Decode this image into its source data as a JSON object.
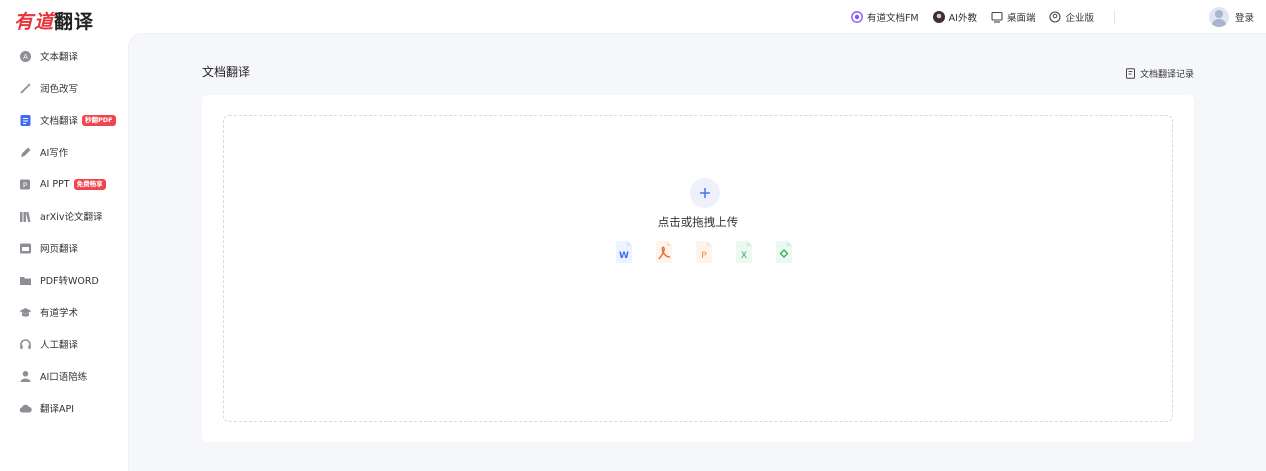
{
  "logo": {
    "brand": "有道",
    "product": "翻译"
  },
  "topnav": {
    "items": [
      {
        "label": "有道文档FM",
        "icon": "podcast-icon"
      },
      {
        "label": "AI外教",
        "icon": "tutor-avatar-icon"
      },
      {
        "label": "桌面端",
        "icon": "desktop-icon"
      },
      {
        "label": "企业版",
        "icon": "enterprise-icon"
      }
    ],
    "login": "登录"
  },
  "sidebar": {
    "items": [
      {
        "label": "文本翻译",
        "icon": "text-translate-icon"
      },
      {
        "label": "润色改写",
        "icon": "magic-wand-icon"
      },
      {
        "label": "文档翻译",
        "icon": "document-icon",
        "badge": "秒翻PDF"
      },
      {
        "label": "AI写作",
        "icon": "pen-icon"
      },
      {
        "label": "AI PPT",
        "icon": "ppt-icon",
        "badge": "免费畅享"
      },
      {
        "label": "arXiv论文翻译",
        "icon": "books-icon"
      },
      {
        "label": "网页翻译",
        "icon": "webpage-icon"
      },
      {
        "label": "PDF转WORD",
        "icon": "folder-icon"
      },
      {
        "label": "有道学术",
        "icon": "graduation-cap-icon"
      },
      {
        "label": "人工翻译",
        "icon": "headset-icon"
      },
      {
        "label": "AI口语陪练",
        "icon": "person-icon"
      },
      {
        "label": "翻译API",
        "icon": "cloud-icon"
      }
    ]
  },
  "main": {
    "title": "文档翻译",
    "history": "文档翻译记录",
    "upload_text": "点击或拖拽上传",
    "file_types": [
      "word-file-icon",
      "pdf-file-icon",
      "ppt-file-icon",
      "excel-file-icon",
      "image-file-icon"
    ]
  },
  "colors": {
    "brand_red": "#e8343b",
    "badge_red": "#f0454f",
    "accent_blue": "#3d6cf5",
    "sidebar_active_blue": "#3d6cf5",
    "background": "#f6f7fb"
  }
}
